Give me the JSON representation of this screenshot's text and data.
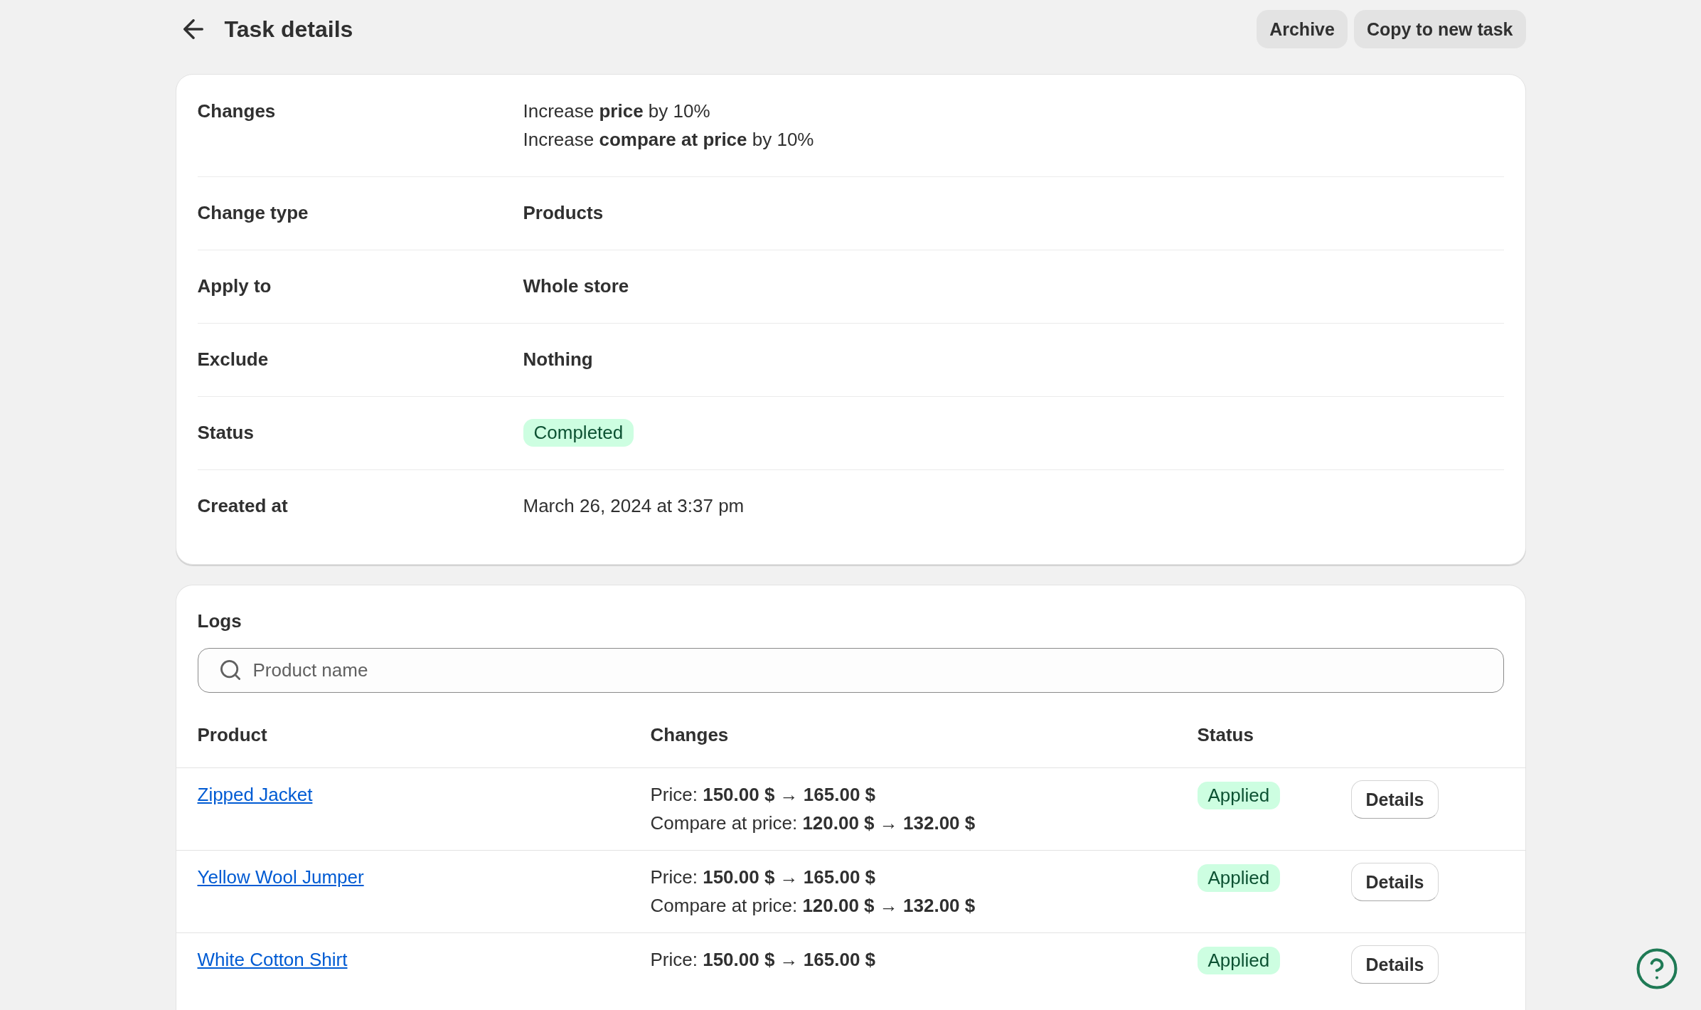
{
  "header": {
    "title": "Task details",
    "actions": [
      {
        "label": "Archive"
      },
      {
        "label": "Copy to new task"
      }
    ]
  },
  "details": [
    {
      "label": "Changes",
      "kind": "lines",
      "lines": [
        "Increase **price** by 10%",
        "Increase **compare at price** by 10%"
      ]
    },
    {
      "label": "Change type",
      "kind": "strong",
      "value": "Products"
    },
    {
      "label": "Apply to",
      "kind": "strong",
      "value": "Whole store"
    },
    {
      "label": "Exclude",
      "kind": "strong",
      "value": "Nothing"
    },
    {
      "label": "Status",
      "kind": "badge",
      "value": "Completed"
    },
    {
      "label": "Created at",
      "kind": "plain",
      "value": "March 26, 2024 at 3:37 pm"
    }
  ],
  "logs": {
    "title": "Logs",
    "search": {
      "placeholder": "Product name"
    },
    "table": {
      "columns": [
        "Product",
        "Changes",
        "Status"
      ],
      "rows": [
        {
          "product": "Zipped Jacket",
          "changes": [
            "Price: **150.00 $ → 165.00 $**",
            "Compare at price: **120.00 $ → 132.00 $**"
          ],
          "status": "Applied",
          "action": "Details"
        },
        {
          "product": "Yellow Wool Jumper",
          "changes": [
            "Price: **150.00 $ → 165.00 $**",
            "Compare at price: **120.00 $ → 132.00 $**"
          ],
          "status": "Applied",
          "action": "Details"
        },
        {
          "product": "White Cotton Shirt",
          "changes": [
            "Price: **150.00 $ → 165.00 $**"
          ],
          "status": "Applied",
          "action": "Details"
        }
      ]
    }
  }
}
